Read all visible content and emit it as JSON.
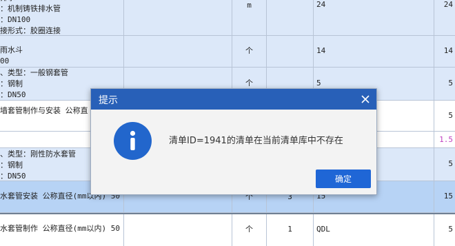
{
  "rows": [
    {
      "desc": [
        "排水",
        "：机制铸铁排水管",
        "：DN100",
        "接形式：胶圈连接"
      ],
      "unit": "m",
      "qty_code": "24",
      "qty": "24"
    },
    {
      "desc": [
        "雨水斗",
        "00"
      ],
      "unit": "个",
      "qty_code": "14",
      "qty": "14"
    },
    {
      "desc": [
        "、类型：一般钢套管",
        "：钢制",
        "：DN50"
      ],
      "unit": "个",
      "qty_code": "5",
      "qty": "5"
    },
    {
      "desc": [
        "墙套管制作与安装 公称直"
      ],
      "unit": "",
      "qty_code": "",
      "qty": "5"
    },
    {
      "desc": [],
      "unit": "",
      "qty_code": "",
      "qty": "1.5"
    },
    {
      "desc": [
        "、类型：刚性防水套管",
        "：钢制",
        "：DN50"
      ],
      "unit": "",
      "qty_code": "",
      "qty": "5"
    },
    {
      "desc": [
        "水套管安装 公称直径(mm以内) 50"
      ],
      "unit": "个",
      "num": "3",
      "qty_code": "15",
      "qty": "15"
    },
    {
      "desc": [
        "水套管制作 公称直径(mm以内) 50"
      ],
      "unit": "个",
      "num": "1",
      "qty_code": "QDL",
      "qty": "5"
    }
  ],
  "dialog": {
    "title": "提示",
    "message": "清单ID=1941的清单在当前清单库中不存在",
    "ok_label": "确定"
  }
}
